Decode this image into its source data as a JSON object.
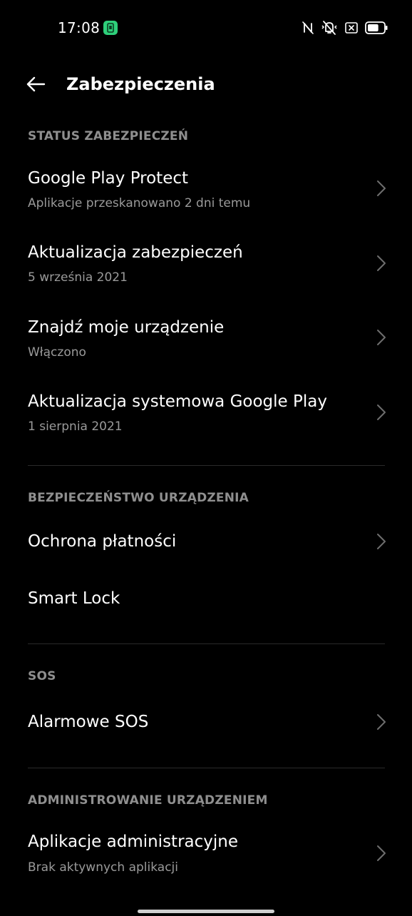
{
  "status_bar": {
    "time": "17:08",
    "icons": [
      "app-notification-icon",
      "nfc-off-icon",
      "vibrate-off-icon",
      "no-sim-icon",
      "battery-icon"
    ],
    "battery_level": 0.7,
    "accent": "#2ecf7a"
  },
  "header": {
    "back_icon": "arrow-left-icon",
    "title": "Zabezpieczenia"
  },
  "sections": {
    "status": {
      "header": "STATUS ZABEZPIECZEŃ",
      "items": [
        {
          "title": "Google Play Protect",
          "subtitle": "Aplikacje przeskanowano 2 dni temu"
        },
        {
          "title": "Aktualizacja zabezpieczeń",
          "subtitle": "5 września 2021"
        },
        {
          "title": "Znajdź moje urządzenie",
          "subtitle": "Włączono"
        },
        {
          "title": "Aktualizacja systemowa Google Play",
          "subtitle": "1 sierpnia 2021"
        }
      ]
    },
    "device": {
      "header": "BEZPIECZEŃSTWO URZĄDZENIA",
      "items": [
        {
          "title": "Ochrona płatności"
        },
        {
          "title": "Smart Lock"
        }
      ]
    },
    "sos": {
      "header": "SOS",
      "items": [
        {
          "title": "Alarmowe SOS"
        }
      ]
    },
    "admin": {
      "header": "ADMINISTROWANIE URZĄDZENIEM",
      "items": [
        {
          "title": "Aplikacje administracyjne",
          "subtitle": "Brak aktywnych aplikacji"
        }
      ]
    }
  },
  "colors": {
    "background": "#000000",
    "title_text": "#ffffff",
    "subtitle_text": "#9a9a9a",
    "section_header": "#8f8f8f",
    "chevron": "#6e6e6e"
  }
}
